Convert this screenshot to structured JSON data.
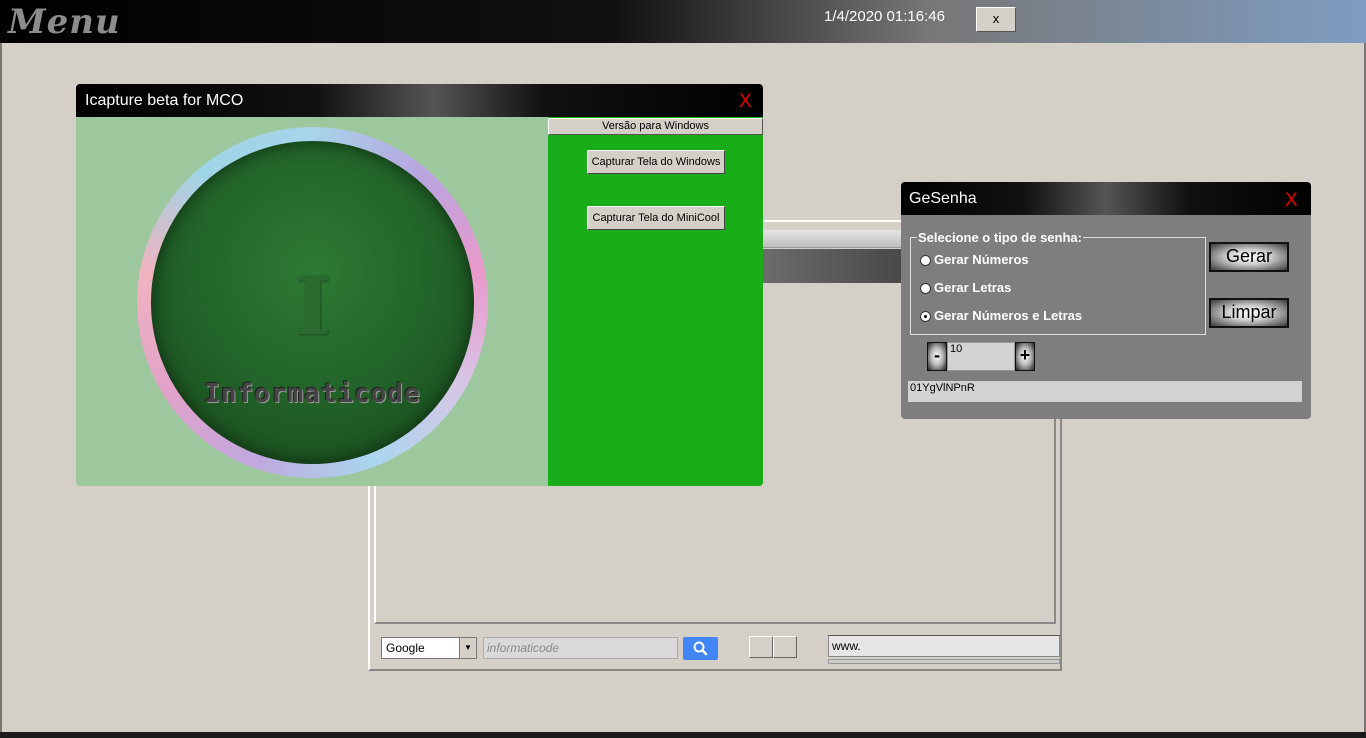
{
  "topbar": {
    "title": "Menu",
    "datetime": "1/4/2020 01:16:46",
    "close_label": "x"
  },
  "browser": {
    "engine": "Google",
    "search_placeholder": "informaticode",
    "url_value": "www."
  },
  "icapture": {
    "title": "Icapture beta for MCO",
    "close_label": "X",
    "logo_letter": "I",
    "logo_brand": "Informaticode",
    "tab_label": "Versão para Windows",
    "btn_windows": "Capturar Tela do Windows",
    "btn_minicool": "Capturar Tela do MiniCool"
  },
  "gesenha": {
    "title": "GeSenha",
    "close_label": "X",
    "group_label": "Selecione o tipo de senha:",
    "options": [
      "Gerar Números",
      "Gerar Letras",
      "Gerar Números e Letras"
    ],
    "selected_option": "Gerar Números e Letras",
    "generate_label": "Gerar",
    "clear_label": "Limpar",
    "minus_label": "-",
    "plus_label": "+",
    "length_value": "10",
    "password_output": "01YgVlNPnR"
  },
  "colors": {
    "close_red": "#e00000",
    "icapture_green": "#1aad1a",
    "search_blue": "#4285f4"
  }
}
